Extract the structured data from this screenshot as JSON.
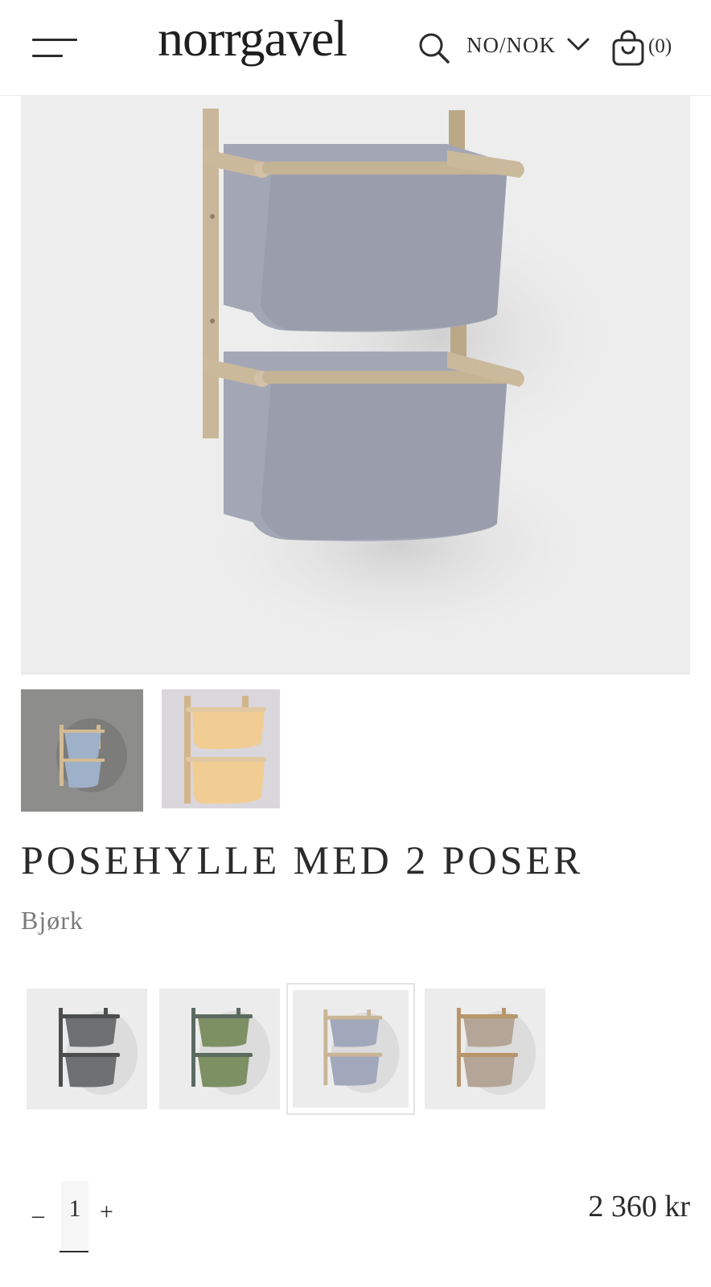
{
  "header": {
    "logo": "norrgavel",
    "locale": "NO/NOK",
    "cart_count": "(0)",
    "icons": [
      "menu-icon",
      "search-icon",
      "chevron-down-icon",
      "cart-icon"
    ]
  },
  "product": {
    "title": "POSEHYLLE MED 2 POSER",
    "variant_name": "Bjørk",
    "price": "2 360 kr",
    "quantity": "1",
    "qty_minus": "–",
    "qty_plus": "+"
  },
  "gallery": {
    "thumbnails": [
      {
        "bag_color": "#9fb0c9",
        "frame_color": "#d5bb93",
        "bg": "#8d8d8b"
      },
      {
        "bag_color": "#f1cd94",
        "frame_color": "#d2b58a",
        "bg": "#d9d6dc"
      }
    ]
  },
  "variants": [
    {
      "frame_color": "#4b4d4e",
      "bag_color": "#6d6f71",
      "selected": false
    },
    {
      "frame_color": "#5c6a60",
      "bag_color": "#7d9063",
      "selected": false
    },
    {
      "frame_color": "#c8b596",
      "bag_color": "#a2a8bb",
      "selected": true
    },
    {
      "frame_color": "#b9956b",
      "bag_color": "#b4a596",
      "selected": false
    }
  ],
  "colors": {
    "hero_bg": "#ededed",
    "hero_frame": "#c9b79a",
    "hero_bag": "#9ea2b0",
    "text": "#2b2b2b",
    "muted": "#7a7a7a"
  }
}
